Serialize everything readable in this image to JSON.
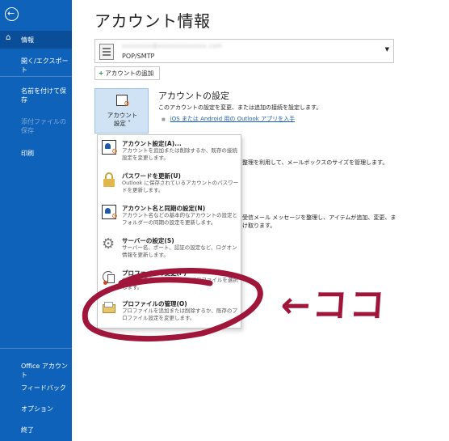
{
  "sidebar": {
    "back_icon": "back-arrow-icon",
    "items": [
      {
        "label": "情報",
        "icon": "home-icon",
        "active": true,
        "disabled": false
      },
      {
        "label": "開く/エクスポート",
        "active": false,
        "disabled": false
      },
      {
        "label": "名前を付けて保存",
        "active": false,
        "disabled": false
      },
      {
        "label": "添付ファイルの保存",
        "active": false,
        "disabled": true
      },
      {
        "label": "印刷",
        "active": false,
        "disabled": false
      }
    ],
    "bottom_items": [
      {
        "label": "Office アカウント"
      },
      {
        "label": "フィードバック"
      },
      {
        "label": "オプション"
      },
      {
        "label": "終了"
      }
    ],
    "bg_color": "#0f62b9"
  },
  "page_title": "アカウント情報",
  "account": {
    "email": "xxxxxxxx@xxxxxxxxxxxxx.com",
    "type": "POP/SMTP"
  },
  "add_account_label": "アカウントの追加",
  "settings_tile": {
    "line1": "アカウント",
    "line2": "設定 ˅"
  },
  "section": {
    "title": "アカウントの設定",
    "description": "このアカウントの設定を変更、または追加の接続を設定します。",
    "link": "iOS または Android 用の Outlook アプリを入手"
  },
  "background_text": {
    "line1": "整理を利用して、メールボックスのサイズを管理します。",
    "line2": "受信メール メッセージを整理し、アイテムが追加、変更、ま",
    "line3": "け取ります。"
  },
  "menu": {
    "items": [
      {
        "title": "アカウント設定(A)...",
        "desc": "アカウントを追加または削除するか、既存の接続設定を変更します。",
        "icon": "account-settings-icon"
      },
      {
        "title": "パスワードを更新(U)",
        "desc": "Outlook に保存されているアカウントのパスワードを更新します。",
        "icon": "lock-icon"
      },
      {
        "title": "アカウント名と同期の設定(N)",
        "desc": "アカウント名などの基本的なアカウントの設定とフォルダーの同期の設定を更新します。",
        "icon": "account-sync-icon"
      },
      {
        "title": "サーバーの設定(S)",
        "desc": "サーバー名、ポート、認証の設定など、ログオン情報を更新します。",
        "icon": "gear-icon"
      },
      {
        "title": "プロファイルの変更(P)",
        "desc": "Outlook を再起動して、別のプロファイルを選択します。",
        "icon": "profile-change-icon"
      },
      {
        "title": "プロファイルの管理(O)",
        "desc": "プロファイルを追加または削除するか、既存のプロファイル設定を変更します。",
        "icon": "profile-folder-icon"
      }
    ]
  },
  "annotation": {
    "text": "←ココ",
    "color": "#a0163a"
  }
}
